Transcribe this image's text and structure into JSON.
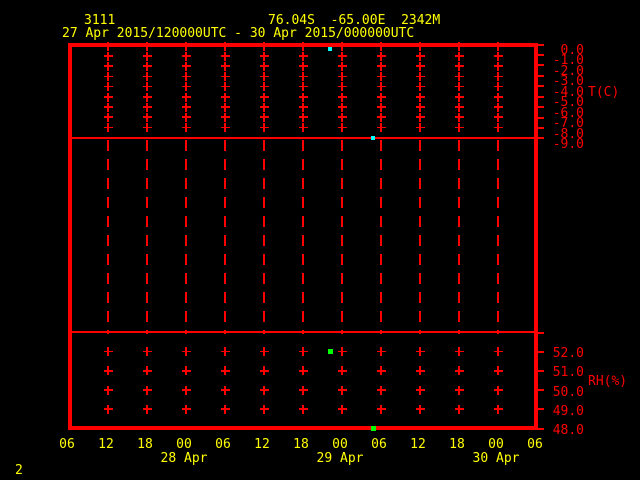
{
  "header": {
    "station_id": "3111",
    "latitude": "76.04S",
    "longitude": "-65.00E",
    "elevation": "2342M",
    "period": "27 Apr 2015/120000UTC - 30 Apr 2015/000000UTC"
  },
  "page_number": "2",
  "colors": {
    "background": "#000000",
    "frame_and_grid": "#ff0000",
    "text": "#ffff00",
    "temperature_marker": "#00ffff",
    "humidity_marker": "#00ff00"
  },
  "temp_axis": {
    "name": "T(C)",
    "tick_labels": [
      "0.0",
      "-1.0",
      "-2.0",
      "-3.0",
      "-4.0",
      "-5.0",
      "-6.0",
      "-7.0",
      "-8.0",
      "-9.0"
    ]
  },
  "rh_axis": {
    "name": "RH(%)",
    "tick_labels": [
      "52.0",
      "51.0",
      "50.0",
      "49.0",
      "48.0"
    ]
  },
  "time_axis": {
    "tick_labels": [
      "06",
      "12",
      "18",
      "00",
      "06",
      "12",
      "18",
      "00",
      "06",
      "12",
      "18",
      "00",
      "06"
    ],
    "date_labels": [
      "28 Apr",
      "29 Apr",
      "30 Apr"
    ]
  },
  "chart_data": [
    {
      "type": "scatter",
      "panel": "temperature",
      "ylabel": "T(C)",
      "ylim": [
        -9.0,
        0.0
      ],
      "y_ticks": [
        0.0,
        -1.0,
        -2.0,
        -3.0,
        -4.0,
        -5.0,
        -6.0,
        -7.0,
        -8.0,
        -9.0
      ],
      "x_tick_interval_hours": 6,
      "x_tick_labels": [
        "06",
        "12",
        "18",
        "00",
        "06",
        "12",
        "18",
        "00",
        "06",
        "12",
        "18",
        "00",
        "06"
      ],
      "grid": "cross marks at 6-hour / 1-degree intersections",
      "legend_position": "none",
      "marker_color": "#00ffff",
      "points": [
        {
          "time_utc_estimate": "28 Apr ~2200UTC",
          "hours_after_plot_start": 34.2,
          "value": -0.4
        },
        {
          "time_utc_estimate": "29 Apr ~0500UTC",
          "hours_after_plot_start": 40.8,
          "value": -9.0
        }
      ]
    },
    {
      "type": "scatter",
      "panel": "relative_humidity",
      "ylabel": "RH(%)",
      "ylim": [
        48.0,
        53.0
      ],
      "y_ticks": [
        53.0,
        52.0,
        51.0,
        50.0,
        49.0,
        48.0
      ],
      "x_tick_interval_hours": 6,
      "x_tick_labels": [
        "06",
        "12",
        "18",
        "00",
        "06",
        "12",
        "18",
        "00",
        "06",
        "12",
        "18",
        "00",
        "06"
      ],
      "grid": "cross marks at 6-hour / 1-percent intersections",
      "legend_position": "none",
      "marker_color": "#00ff00",
      "points": [
        {
          "time_utc_estimate": "28 Apr ~2200UTC",
          "hours_after_plot_start": 34.2,
          "value": 52.0
        },
        {
          "time_utc_estimate": "29 Apr ~0500UTC",
          "hours_after_plot_start": 40.9,
          "value": 48.0
        }
      ]
    }
  ]
}
